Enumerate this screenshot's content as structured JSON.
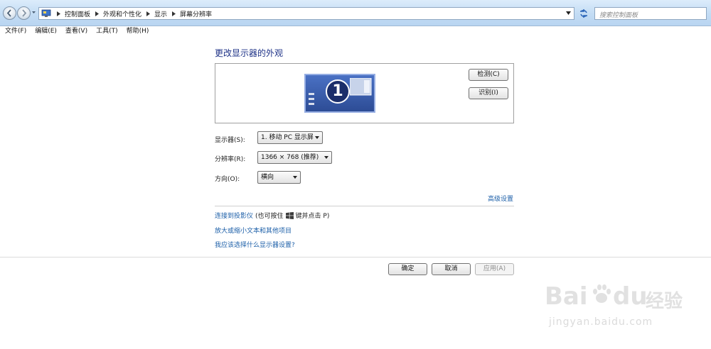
{
  "addressbar": {
    "breadcrumbs": [
      "控制面板",
      "外观和个性化",
      "显示",
      "屏幕分辨率"
    ],
    "search_placeholder": "搜索控制面板"
  },
  "menu": [
    "文件(F)",
    "编辑(E)",
    "查看(V)",
    "工具(T)",
    "帮助(H)"
  ],
  "page": {
    "title": "更改显示器的外观",
    "monitor_number": "1",
    "detect_button": "检测(C)",
    "identify_button": "识别(I)"
  },
  "settings": {
    "display_label": "显示器(S):",
    "display_value": "1. 移动 PC 显示屏",
    "resolution_label": "分辨率(R):",
    "resolution_value": "1366 × 768 (推荐)",
    "orientation_label": "方向(O):",
    "orientation_value": "横向"
  },
  "links": {
    "advanced": "高级设置",
    "projector_link": "连接到投影仪",
    "projector_hint_before": "(也可按住",
    "projector_hint_after": "键并点击 P)",
    "text_size": "放大或缩小文本和其他项目",
    "which_settings": "我应该选择什么显示器设置?"
  },
  "footer": {
    "ok": "确定",
    "cancel": "取消",
    "apply": "应用(A)"
  },
  "watermark": {
    "brand": "Bai",
    "brand2": "du",
    "brand_cn": "经验",
    "url": "jingyan.baidu.com"
  },
  "colors": {
    "link": "#1c5fa8",
    "title": "#1e3287",
    "monitor": "#3a5fb3"
  }
}
